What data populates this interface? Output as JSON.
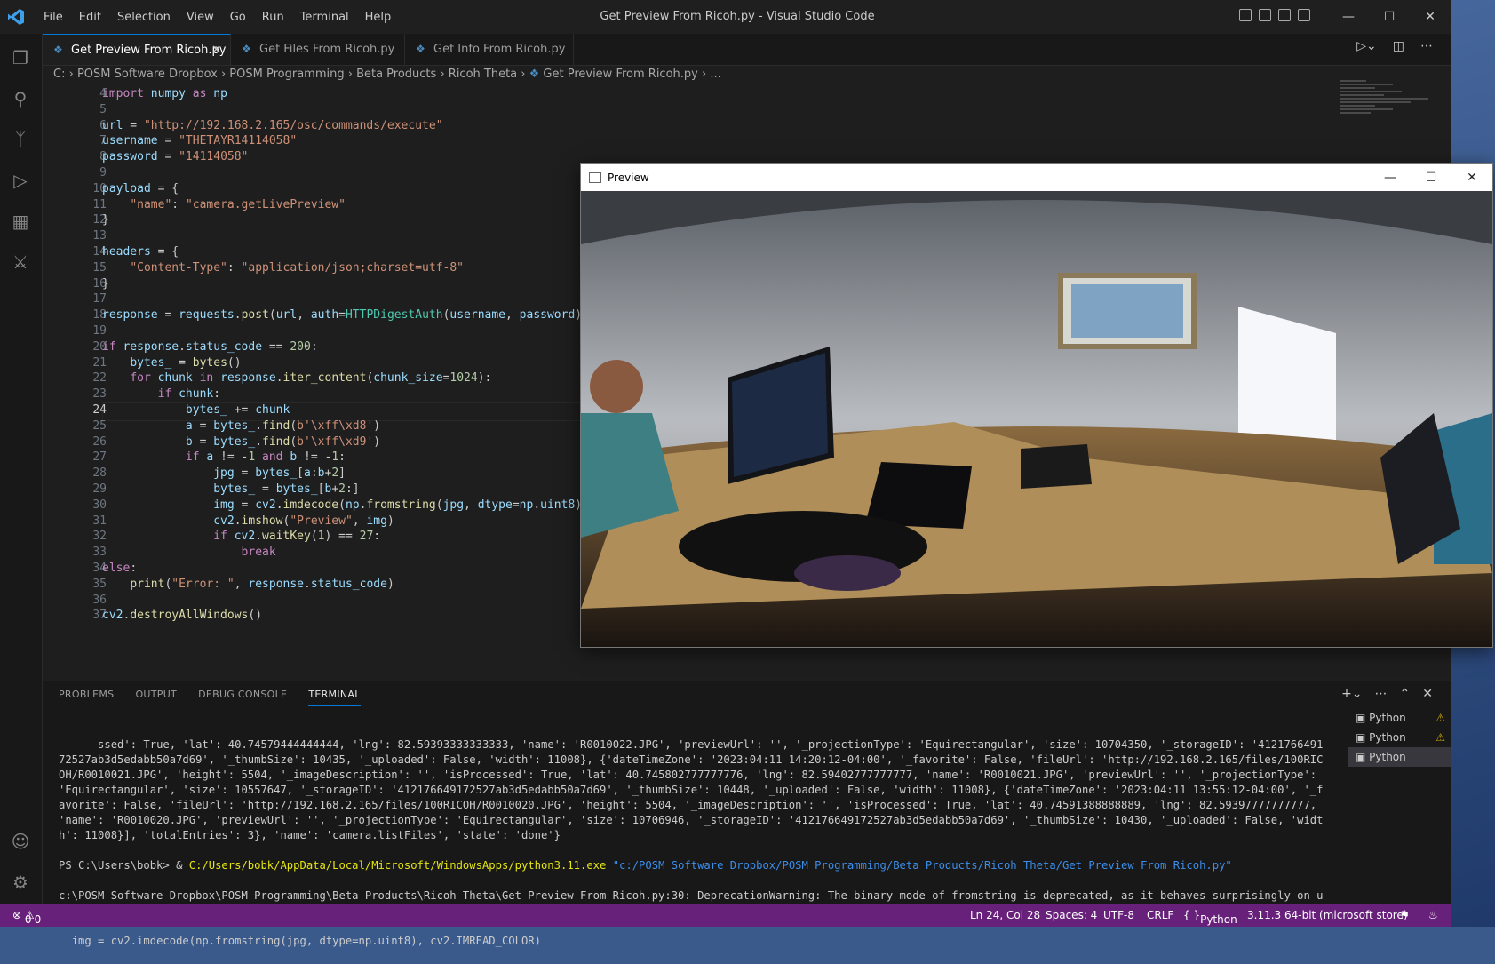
{
  "window": {
    "title": "Get Preview From Ricoh.py - Visual Studio Code"
  },
  "menu": [
    "File",
    "Edit",
    "Selection",
    "View",
    "Go",
    "Run",
    "Terminal",
    "Help"
  ],
  "tabs": [
    {
      "label": "Get Preview From Ricoh.py",
      "active": true
    },
    {
      "label": "Get Files From Ricoh.py",
      "active": false
    },
    {
      "label": "Get Info From Ricoh.py",
      "active": false
    }
  ],
  "breadcrumb": [
    "C:",
    "POSM Software Dropbox",
    "POSM Programming",
    "Beta Products",
    "Ricoh Theta",
    "Get Preview From Ricoh.py",
    "..."
  ],
  "code": {
    "line_numbers": [
      "4",
      "5",
      "6",
      "7",
      "8",
      "9",
      "10",
      "11",
      "12",
      "13",
      "14",
      "15",
      "16",
      "17",
      "18",
      "19",
      "20",
      "21",
      "22",
      "23",
      "24",
      "25",
      "26",
      "27",
      "28",
      "29",
      "30",
      "31",
      "32",
      "33",
      "34",
      "35",
      "36",
      "37"
    ],
    "current_line": "24",
    "lines": [
      "import numpy as np",
      "",
      "url = \"http://192.168.2.165/osc/commands/execute\"",
      "username = \"THETAYR14114058\"",
      "password = \"14114058\"",
      "",
      "payload = {",
      "    \"name\": \"camera.getLivePreview\"",
      "}",
      "",
      "headers = {",
      "    \"Content-Type\": \"application/json;charset=utf-8\"",
      "}",
      "",
      "response = requests.post(url, auth=HTTPDigestAuth(username, password),",
      "",
      "if response.status_code == 200:",
      "    bytes_ = bytes()",
      "    for chunk in response.iter_content(chunk_size=1024):",
      "        if chunk:",
      "            bytes_ += chunk",
      "            a = bytes_.find(b'\\xff\\xd8')",
      "            b = bytes_.find(b'\\xff\\xd9')",
      "            if a != -1 and b != -1:",
      "                jpg = bytes_[a:b+2]",
      "                bytes_ = bytes_[b+2:]",
      "                img = cv2.imdecode(np.fromstring(jpg, dtype=np.uint8),",
      "                cv2.imshow(\"Preview\", img)",
      "                if cv2.waitKey(1) == 27:",
      "                    break",
      "else:",
      "    print(\"Error: \", response.status_code)",
      "",
      "cv2.destroyAllWindows()"
    ]
  },
  "preview_window": {
    "title": "Preview"
  },
  "panel": {
    "tabs": [
      "PROBLEMS",
      "OUTPUT",
      "DEBUG CONSOLE",
      "TERMINAL"
    ],
    "active_tab": "TERMINAL",
    "terminal_text": "ssed': True, 'lat': 40.74579444444444, 'lng': 82.59393333333333, 'name': 'R0010022.JPG', 'previewUrl': '', '_projectionType': 'Equirectangular', 'size': 10704350, '_storageID': '412176649172527ab3d5edabb50a7d69', '_thumbSize': 10435, '_uploaded': False, 'width': 11008}, {'dateTimeZone': '2023:04:11 14:20:12-04:00', '_favorite': False, 'fileUrl': 'http://192.168.2.165/files/100RICOH/R0010021.JPG', 'height': 5504, '_imageDescription': '', 'isProcessed': True, 'lat': 40.745802777777776, 'lng': 82.59402777777777, 'name': 'R0010021.JPG', 'previewUrl': '', '_projectionType': 'Equirectangular', 'size': 10557647, '_storageID': '412176649172527ab3d5edabb50a7d69', '_thumbSize': 10448, '_uploaded': False, 'width': 11008}, {'dateTimeZone': '2023:04:11 13:55:12-04:00', '_favorite': False, 'fileUrl': 'http://192.168.2.165/files/100RICOH/R0010020.JPG', 'height': 5504, '_imageDescription': '', 'isProcessed': True, 'lat': 40.74591388888889, 'lng': 82.59397777777777, 'name': 'R0010020.JPG', 'previewUrl': '', '_projectionType': 'Equirectangular', 'size': 10706946, '_storageID': '412176649172527ab3d5edabb50a7d69', '_thumbSize': 10430, '_uploaded': False, 'width': 11008}], 'totalEntries': 3}, 'name': 'camera.listFiles', 'state': 'done'}",
    "prompt": "PS C:\\Users\\bobk> & ",
    "python_exe": "C:/Users/bobk/AppData/Local/Microsoft/WindowsApps/python3.11.exe",
    "script_path": "\"c:/POSM Software Dropbox/POSM Programming/Beta Products/Ricoh Theta/Get Preview From Ricoh.py\"",
    "warning_text": "c:\\POSM Software Dropbox\\POSM Programming\\Beta Products\\Ricoh Theta\\Get Preview From Ricoh.py:30: DeprecationWarning: The binary mode of fromstring is deprecated, as it behaves surprisingly on unicode inputs. Use frombuffer instead",
    "warning_code": "  img = cv2.imdecode(np.fromstring(jpg, dtype=np.uint8), cv2.IMREAD_COLOR)",
    "terminals": [
      {
        "label": "Python",
        "warning": true
      },
      {
        "label": "Python",
        "warning": true
      },
      {
        "label": "Python",
        "warning": false
      }
    ]
  },
  "status": {
    "errors": "0",
    "warnings": "0",
    "position": "Ln 24, Col 28",
    "spaces": "Spaces: 4",
    "encoding": "UTF-8",
    "eol": "CRLF",
    "language": "Python",
    "interpreter": "3.11.3 64-bit (microsoft store)"
  }
}
